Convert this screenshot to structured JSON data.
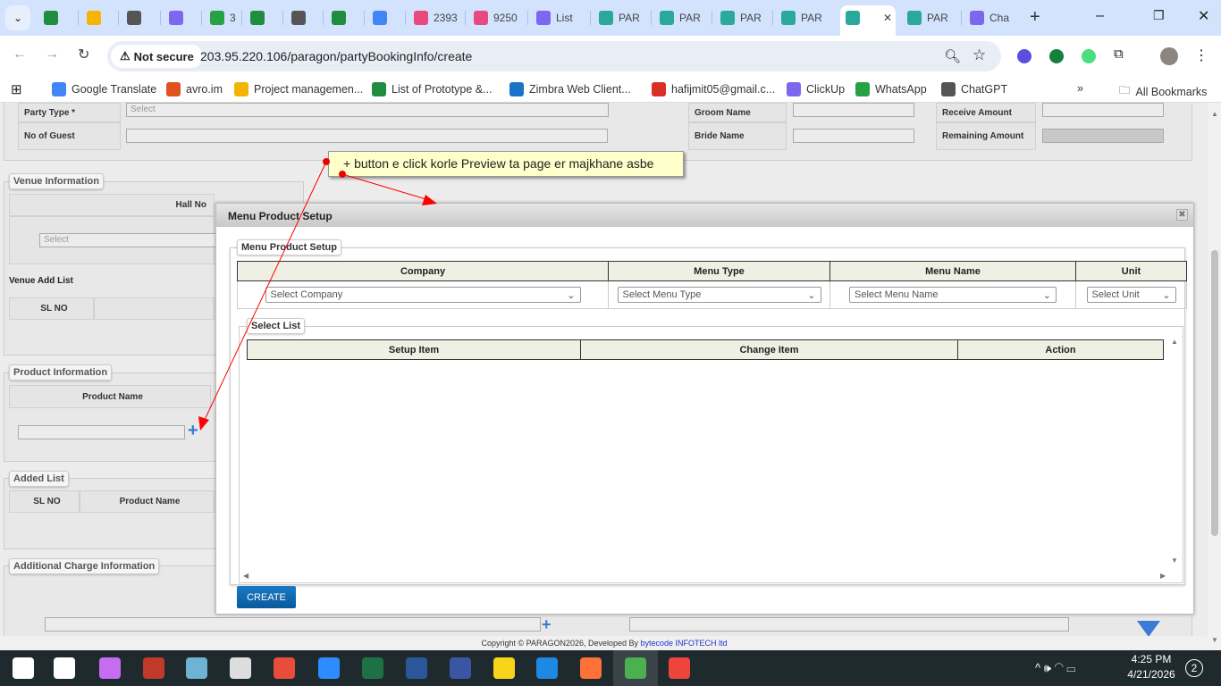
{
  "browser": {
    "tabs": [
      {
        "icon": "sheets-icon",
        "label": ""
      },
      {
        "icon": "drive-icon",
        "label": ""
      },
      {
        "icon": "chatgpt-icon",
        "label": ""
      },
      {
        "icon": "clickup-icon",
        "label": ""
      },
      {
        "icon": "whatsapp-icon",
        "label": "3"
      },
      {
        "icon": "sheets-icon",
        "label": ""
      },
      {
        "icon": "globe-icon",
        "label": ""
      },
      {
        "icon": "sheets-icon",
        "label": ""
      },
      {
        "icon": "docs-icon",
        "label": ""
      },
      {
        "icon": "app-icon",
        "label": "2393"
      },
      {
        "icon": "app-icon",
        "label": "9250"
      },
      {
        "icon": "clickup-icon",
        "label": "List"
      },
      {
        "icon": "paragon-icon",
        "label": "PAR"
      },
      {
        "icon": "paragon-icon",
        "label": "PAR"
      },
      {
        "icon": "paragon-icon",
        "label": "PAR"
      },
      {
        "icon": "paragon-icon",
        "label": "PAR"
      },
      {
        "icon": "paragon-icon",
        "label": ""
      },
      {
        "icon": "paragon-icon",
        "label": "PAR"
      },
      {
        "icon": "clickup-icon",
        "label": "Cha"
      }
    ],
    "security": "Not secure",
    "url": "203.95.220.106/paragon/partyBookingInfo/create",
    "bookmarks": [
      "Google Translate",
      "avro.im",
      "Project managemen...",
      "List of Prototype &...",
      "Zimbra Web Client...",
      "hafijmit05@gmail.c...",
      "ClickUp",
      "WhatsApp",
      "ChatGPT"
    ],
    "all_bookmarks": "All Bookmarks"
  },
  "background_form": {
    "party_type_label": "Party Type *",
    "party_type_value": "Select",
    "no_of_guest": "No of Guest",
    "groom_name": "Groom Name",
    "bride_name": "Bride Name",
    "receive_amount": "Receive Amount",
    "remaining_amount": "Remaining Amount",
    "venue_info": "Venue Information",
    "hall_no": "Hall No",
    "venue_select": "Select",
    "venue_add_list": "Venue Add List",
    "sl_no": "SL NO",
    "product_info": "Product Information",
    "product_name": "Product Name",
    "added_list": "Added List",
    "added_sl_no": "SL NO",
    "added_product_name": "Product Name",
    "additional_charge": "Additional Charge Information"
  },
  "annotation": "+ button e click korle Preview ta page er majkhane asbe",
  "modal": {
    "title": "Menu Product Setup",
    "fieldset": "Menu Product Setup",
    "columns": [
      "Company",
      "Menu Type",
      "Menu Name",
      "Unit"
    ],
    "selects": [
      "Select Company",
      "Select Menu Type",
      "Select Menu Name",
      "Select Unit"
    ],
    "select_list": "Select List",
    "list_columns": [
      "Setup Item",
      "Change Item",
      "Action"
    ],
    "create": "CREATE"
  },
  "footer": {
    "text": "Copyright © PARAGON2026, Developed By ",
    "link": "bytecode INFOTECH ltd"
  },
  "taskbar": {
    "time": "4:25 PM",
    "date": "4/21/2026",
    "notifications": "2"
  },
  "colors": {
    "accent": "#0a5a9c",
    "annotation": "#ff0000",
    "note": "#ffffcc"
  }
}
